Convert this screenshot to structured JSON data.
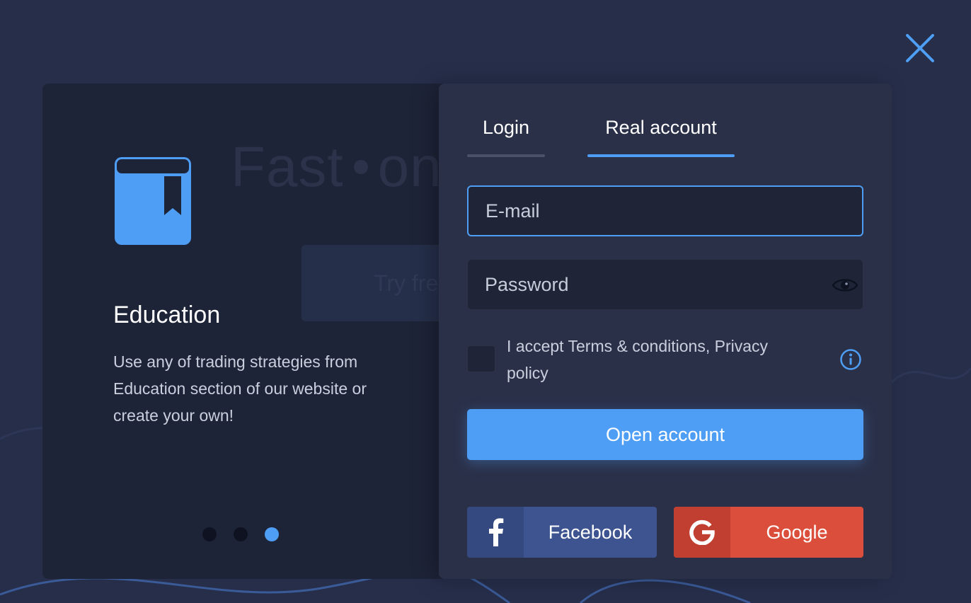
{
  "colors": {
    "accent": "#4f9ef5",
    "background": "#262e4a",
    "panel": "#2a3048",
    "facebook": "#3d5491",
    "google": "#db4e3b"
  },
  "background": {
    "headline_left": "Fast",
    "headline_right": "on",
    "button_text": "Try fre"
  },
  "slide": {
    "icon": "book-bookmark-icon",
    "title": "Education",
    "text": "Use any of trading strategies from Education section of our website or create your own!",
    "dots": [
      {
        "active": false
      },
      {
        "active": false
      },
      {
        "active": true
      }
    ]
  },
  "tabs": [
    {
      "label": "Login",
      "active": false
    },
    {
      "label": "Real account",
      "active": true
    }
  ],
  "form": {
    "email_placeholder": "E-mail",
    "email_value": "",
    "password_placeholder": "Password",
    "password_value": "",
    "password_toggle_icon": "eye-icon",
    "accept_text": "I accept Terms & conditions, Privacy policy",
    "accept_checked": false,
    "info_icon": "info-icon",
    "submit_label": "Open account"
  },
  "social": {
    "facebook_label": "Facebook",
    "google_label": "Google"
  },
  "close_icon": "close-icon"
}
